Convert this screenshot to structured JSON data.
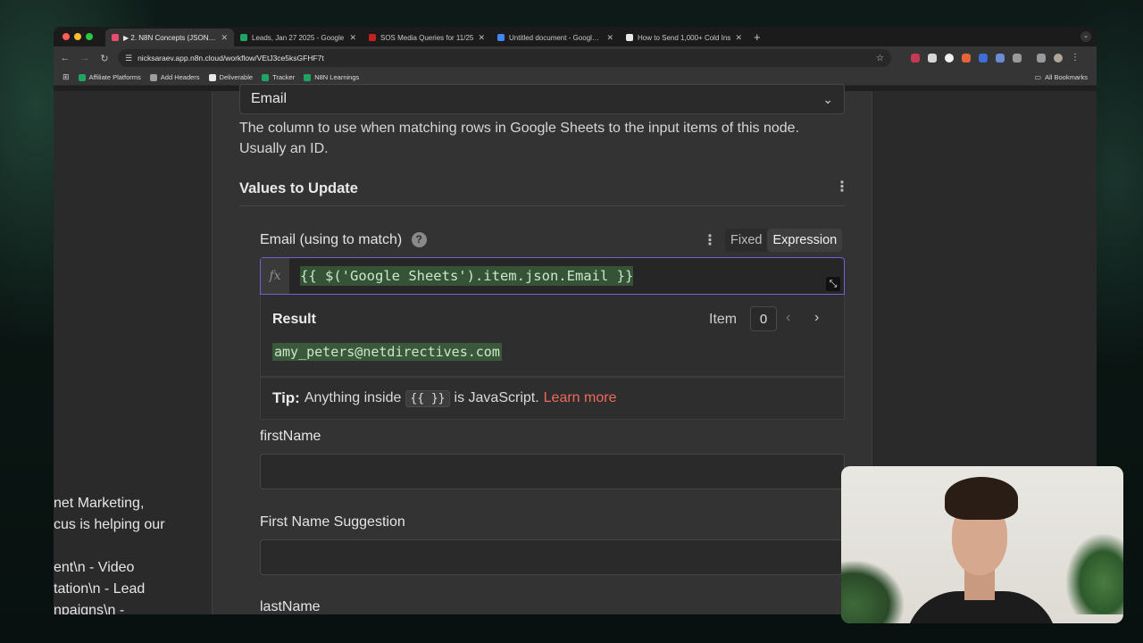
{
  "browser": {
    "tabs": [
      {
        "title": "▶ 2. N8N Concepts (JSON, D",
        "favicon_color": "#ea4b71",
        "active": true
      },
      {
        "title": "Leads, Jan 27 2025 - Google",
        "favicon_color": "#1fa463",
        "active": false
      },
      {
        "title": "SOS Media Queries for 11/25",
        "favicon_color": "#c5221f",
        "active": false
      },
      {
        "title": "Untitled document - Google D",
        "favicon_color": "#4285f4",
        "active": false
      },
      {
        "title": "How to Send 1,000+ Cold Ins",
        "favicon_color": "#e8e8e8",
        "active": false
      }
    ],
    "new_tab": "+",
    "url": "nicksaraev.app.n8n.cloud/workflow/VEtJ3ce5ksGFHF7t",
    "bookmarks": [
      {
        "label": "Affiliate Platforms",
        "icon": "sheets-icon",
        "color": "#1fa463"
      },
      {
        "label": "Add Headers",
        "icon": "gear-icon",
        "color": "#9e9e9e"
      },
      {
        "label": "Deliverable",
        "icon": "doc-icon",
        "color": "#e8e8e8"
      },
      {
        "label": "Tracker",
        "icon": "sheets-icon",
        "color": "#1fa463"
      },
      {
        "label": "N8N Learnings",
        "icon": "sheets-icon",
        "color": "#1fa463"
      }
    ],
    "all_bookmarks": "All Bookmarks"
  },
  "left_pane": {
    "text": "net Marketing,\ncus is helping our\n\nent\\n - Video\ntation\\n - Lead\nnpaigns\\n -"
  },
  "panel": {
    "column_select_value": "Email",
    "column_hint": "The column to use when matching rows in Google Sheets to the input items of this node. Usually an ID.",
    "section_title": "Values to Update",
    "email_field": {
      "label": "Email (using to match)",
      "help": "?",
      "mode_fixed": "Fixed",
      "mode_expression": "Expression",
      "fx": "fx",
      "expression": "{{ $('Google Sheets').item.json.Email }}"
    },
    "result": {
      "title": "Result",
      "item_label": "Item",
      "item_index": "0",
      "value": "amy_peters@netdirectives.com"
    },
    "tip": {
      "label": "Tip:",
      "before": "Anything inside",
      "code": "{{ }}",
      "after": "is JavaScript.",
      "link": "Learn more"
    },
    "fields": [
      {
        "label": "firstName"
      },
      {
        "label": "First Name Suggestion"
      },
      {
        "label": "lastName"
      }
    ]
  }
}
